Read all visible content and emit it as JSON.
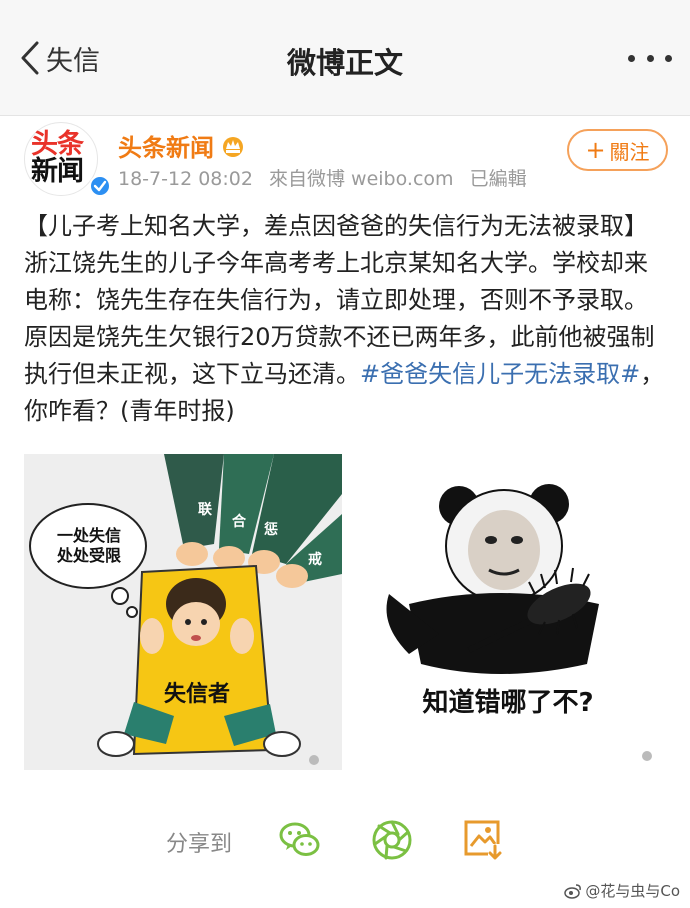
{
  "navbar": {
    "back_label": "失信",
    "title": "微博正文"
  },
  "post": {
    "avatar_text_line1": "头条",
    "avatar_text_line2": "新闻",
    "author": "头条新闻",
    "time": "18-7-12 08:02",
    "source": "來自微博 weibo.com",
    "edited": "已編輯",
    "follow_label": "關注",
    "text_main": "【儿子考上知名大学，差点因爸爸的失信行为无法被录取】浙江饶先生的儿子今年高考考上北京某知名大学。学校却来电称：饶先生存在失信行为，请立即处理，否则不予录取。原因是饶先生欠银行20万贷款不还已两年多，此前他被强制执行但未正视，这下立马还清。",
    "hashtag": "#爸爸失信儿子无法录取#",
    "text_tail": "，你咋看？(青年时报)"
  },
  "images": {
    "left": {
      "bubble_line1": "一处失信",
      "bubble_line2": "处处受限",
      "board_label": "失信者",
      "sleeve_text": [
        "联",
        "合",
        "惩",
        "戒"
      ]
    },
    "right": {
      "caption": "知道错哪了不?"
    }
  },
  "share": {
    "label": "分享到",
    "icons": [
      "wechat-icon",
      "moments-icon",
      "save-image-icon"
    ]
  },
  "watermark": "@花与虫与Co",
  "colors": {
    "accent_orange": "#f07b14",
    "hashtag_blue": "#3b6fb0",
    "toutiao_red": "#e9332a",
    "wechat_green": "#7bc043"
  }
}
